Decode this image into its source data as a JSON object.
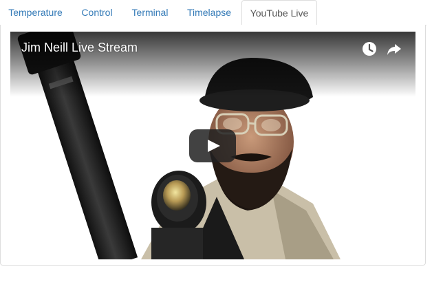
{
  "tabs": [
    {
      "label": "Temperature"
    },
    {
      "label": "Control"
    },
    {
      "label": "Terminal"
    },
    {
      "label": "Timelapse"
    },
    {
      "label": "YouTube Live",
      "active": true
    }
  ],
  "player": {
    "title": "Jim Neill Live Stream",
    "icons": [
      "watch-later-icon",
      "share-icon",
      "play-icon"
    ],
    "play_button_color": "#212121"
  },
  "colors": {
    "tab_link": "#337ab7",
    "tab_active": "#555555",
    "border": "#dddddd"
  }
}
